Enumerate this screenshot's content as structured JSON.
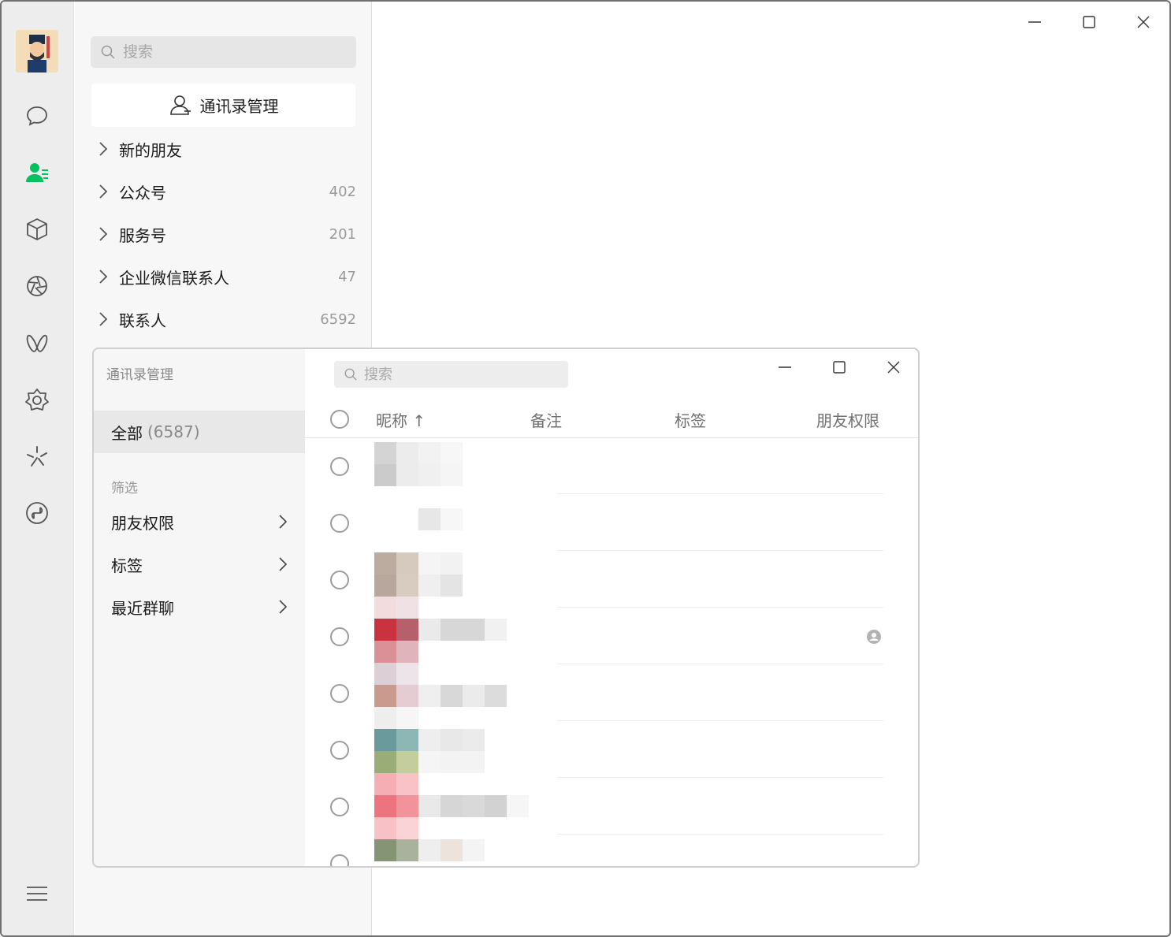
{
  "window_controls": {
    "minimize": "minimize",
    "maximize": "maximize",
    "close": "close"
  },
  "nav": {
    "icons": [
      "avatar",
      "chat-icon",
      "contacts-icon",
      "favorites-icon",
      "moments-icon",
      "channels-icon",
      "mini-programs-icon",
      "look-icon",
      "search-icon",
      "menu-icon"
    ],
    "active_color": "#07c160"
  },
  "contacts": {
    "search_placeholder": "搜索",
    "manage_button": "通讯录管理",
    "groups": [
      {
        "label": "新的朋友",
        "count": ""
      },
      {
        "label": "公众号",
        "count": "402"
      },
      {
        "label": "服务号",
        "count": "201"
      },
      {
        "label": "企业微信联系人",
        "count": "47"
      },
      {
        "label": "联系人",
        "count": "6592"
      }
    ]
  },
  "dialog": {
    "title": "通讯录管理",
    "all_label": "全部",
    "all_count": "(6587)",
    "filter_title": "筛选",
    "filters": [
      "朋友权限",
      "标签",
      "最近群聊"
    ],
    "search_placeholder": "搜索",
    "columns": {
      "nickname": "昵称 ↑",
      "remark": "备注",
      "tags": "标签",
      "permission": "朋友权限"
    },
    "row_count": 8
  }
}
